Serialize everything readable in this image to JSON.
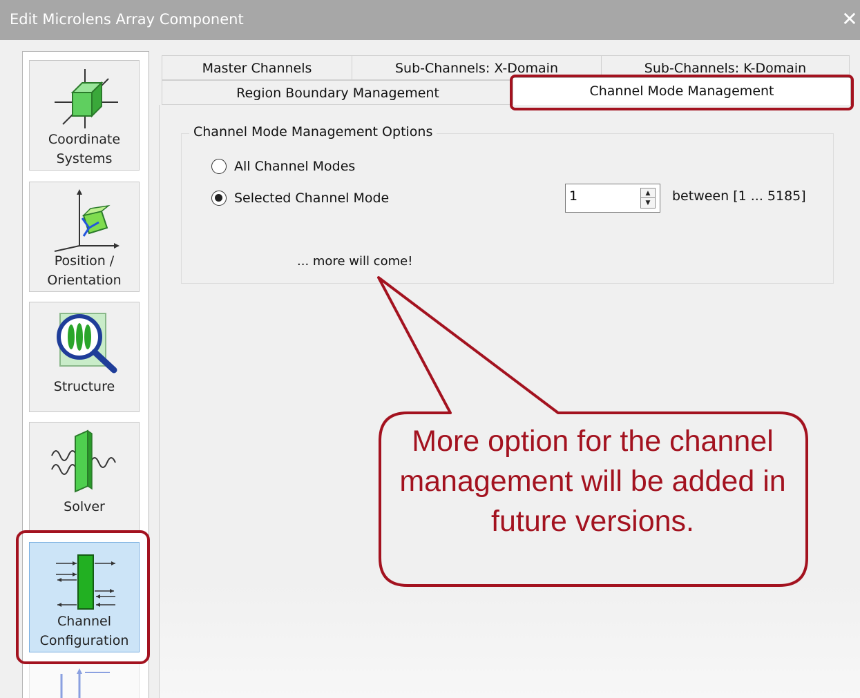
{
  "window": {
    "title": "Edit Microlens Array Component",
    "close_glyph": "✕"
  },
  "sidebar": {
    "items": [
      {
        "label_line1": "Coordinate",
        "label_line2": "Systems",
        "icon": "coordinate-systems-icon"
      },
      {
        "label_line1": "Position /",
        "label_line2": "Orientation",
        "icon": "position-orientation-icon"
      },
      {
        "label_line1": "Structure",
        "icon": "structure-icon"
      },
      {
        "label_line1": "Solver",
        "icon": "solver-icon"
      },
      {
        "label_line1": "Channel",
        "label_line2": "Configuration",
        "icon": "channel-configuration-icon",
        "active": true
      },
      {
        "icon": "partial-next-icon"
      }
    ]
  },
  "tabs": {
    "row_back": [
      "Master Channels",
      "Sub-Channels: X-Domain",
      "Sub-Channels: K-Domain"
    ],
    "row_front": [
      "Region Boundary Management",
      "Channel Mode Management"
    ],
    "selected": "Channel Mode Management"
  },
  "group": {
    "title": "Channel Mode Management Options",
    "option_all": "All Channel Modes",
    "option_selected": "Selected Channel Mode",
    "selected_option": "Selected Channel Mode",
    "mode_value": "1",
    "range_text": "between [1 ... 5185]",
    "more_text": "... more will come!"
  },
  "callout": {
    "text": "More option for the channel management will be added in future versions.",
    "color": "#a3121f"
  }
}
